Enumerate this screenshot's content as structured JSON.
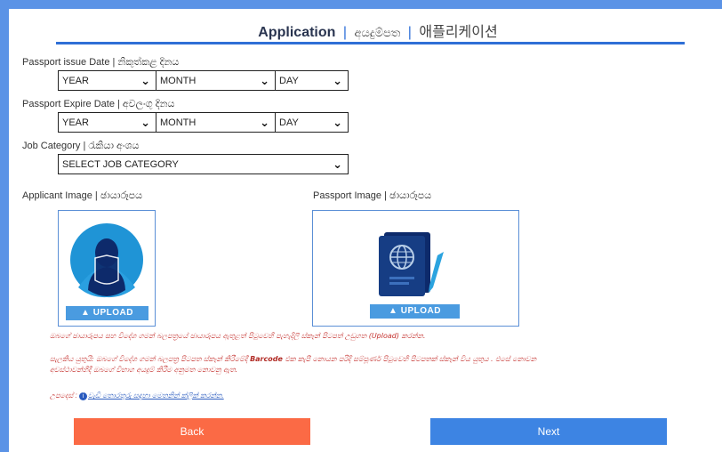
{
  "header": {
    "title_en": "Application",
    "separator": "|",
    "title_si": "අයදුම්පත",
    "title_ko": "애플리케이션"
  },
  "form": {
    "issue_label": "Passport issue Date | නිකුත්කළ දිනය",
    "issue_year": "YEAR",
    "issue_month": "MONTH",
    "issue_day": "DAY",
    "expire_label": "Passport Expire Date | අවලංගු දිනය",
    "expire_year": "YEAR",
    "expire_month": "MONTH",
    "expire_day": "DAY",
    "job_label": "Job Category | රැකියා අංශය",
    "job_value": "SELECT JOB CATEGORY",
    "applicant_label": "Applicant Image | ඡායාරූපය",
    "passport_label": "Passport Image | ඡායාරූපය",
    "upload_label": "UPLOAD"
  },
  "notes": {
    "line1": "ඔබගේ ඡායාරූපය සහ විදේශ ගමන් බලපත්‍රයේ ඡායාරූපය ඇතුළත් පිටුවෙහි පැහැදිලි ස්කෑන් පිටපත් උඩුගත (Upload) කරන්න.",
    "line2a": "සැලකිය යුතුයි: ඔබගේ විදේශ ගමන් බලපත්‍ර පිටපත ස්කෑන් කිරීමේදී",
    "line2_bold": "Barcode",
    "line2b": "එක කැපී නොයන පරිදි සම්පූර්ණ පිටුවෙහි පිටපතක් ස්කෑන් විය යුතුය . එසේ නොවන",
    "line3": "අවස්ථාවන්හිදී ඔබගේ විභාග අයදුම් කිරීම අනුමත නොවනු ඇත.",
    "help_prefix": "උපදෙස් :",
    "help_link": "වැඩි තොරතුරු සඳහා මෙතනින් ක්ලික් කරන්න."
  },
  "actions": {
    "back": "Back",
    "next": "Next"
  },
  "colors": {
    "back": "#fb6a45",
    "next": "#3d84e3",
    "frame": "#5b93e6"
  }
}
